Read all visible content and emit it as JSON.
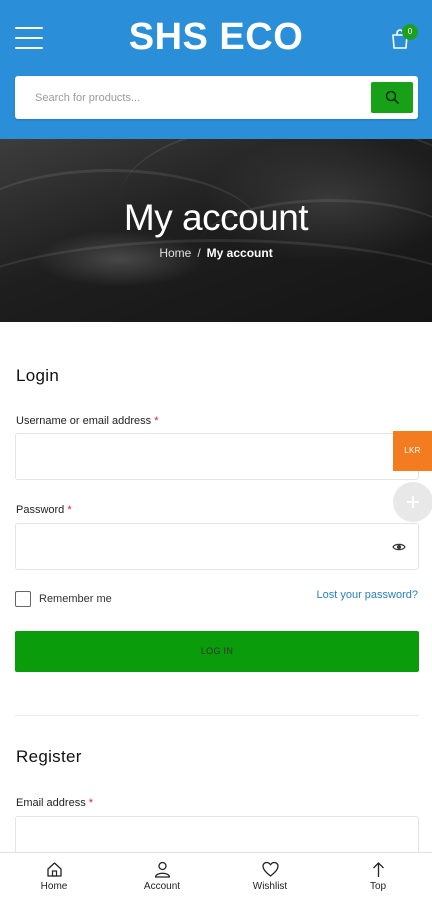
{
  "header": {
    "brand": "SHS ECO",
    "cart_count": "0"
  },
  "search": {
    "placeholder": "Search for products..."
  },
  "hero": {
    "title": "My account",
    "breadcrumb": [
      {
        "label": "Home"
      },
      {
        "label": "My account"
      }
    ],
    "breadcrumb_separator": "/"
  },
  "login": {
    "title": "Login",
    "username_label": "Username or email address",
    "password_label": "Password",
    "required_mark": "*",
    "remember_label": "Remember me",
    "lost_password": "Lost your password?",
    "submit_label": "LOG IN"
  },
  "register": {
    "title": "Register",
    "email_label": "Email address",
    "required_mark": "*"
  },
  "floating": {
    "currency": "LKR"
  },
  "bottom_nav": [
    {
      "label": "Home",
      "icon": "home-icon"
    },
    {
      "label": "Account",
      "icon": "user-icon"
    },
    {
      "label": "Wishlist",
      "icon": "heart-icon"
    },
    {
      "label": "Top",
      "icon": "arrow-up-icon"
    }
  ],
  "colors": {
    "header_blue": "#2a8fd8",
    "brand_green": "#0a9c0a",
    "link_blue": "#2a7fc4",
    "currency_orange": "#f47c20",
    "required_red": "#e02020"
  }
}
